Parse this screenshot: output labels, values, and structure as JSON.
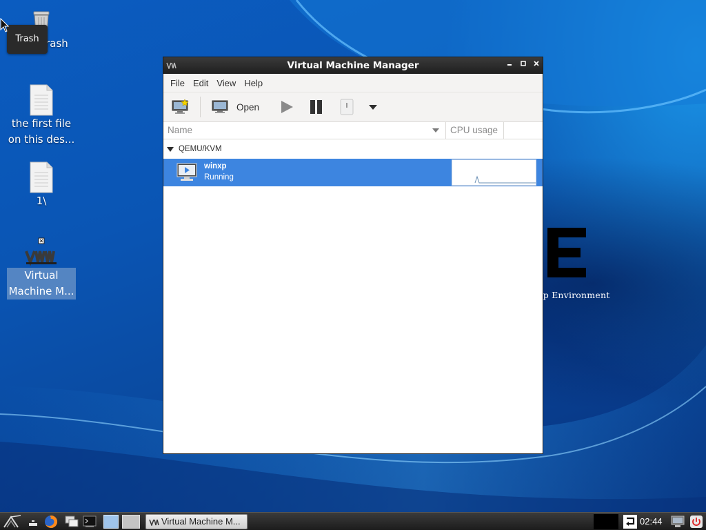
{
  "desktop": {
    "tooltip": "Trash",
    "icons": [
      {
        "label": "Trash"
      },
      {
        "label": "the first file on this des..."
      },
      {
        "label": "1\\"
      },
      {
        "label": "Virtual Machine M..."
      }
    ],
    "brand_text": "op Environment"
  },
  "window": {
    "title": "Virtual Machine Manager",
    "controls": {
      "minimize": "▬",
      "maximize": "□",
      "close": "✕"
    },
    "menu": [
      "File",
      "Edit",
      "View",
      "Help"
    ],
    "toolbar": {
      "open_label": "Open",
      "icons": [
        "new-vm-icon",
        "monitor-icon",
        "play-icon",
        "pause-icon",
        "shutdown-icon",
        "dropdown-arrow-icon"
      ]
    },
    "columns": {
      "name": "Name",
      "cpu": "CPU usage"
    },
    "group": {
      "label": "QEMU/KVM"
    },
    "vm": {
      "name": "winxp",
      "status": "Running"
    }
  },
  "taskbar": {
    "task_label": "Virtual Machine M...",
    "clock": "02:44"
  },
  "colors": {
    "selection": "#3d85e0",
    "titlebar": "#2a2a2a",
    "desktop": "#0a55b4"
  }
}
